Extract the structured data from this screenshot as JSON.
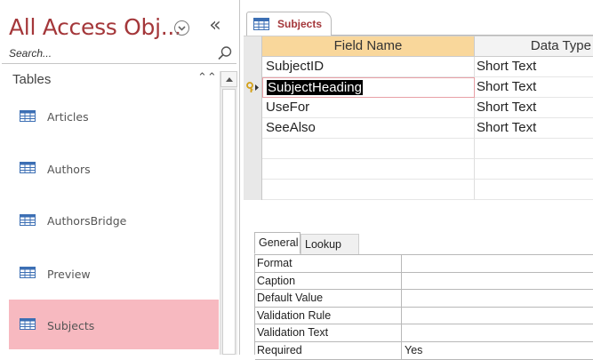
{
  "nav": {
    "title": "All Access Obj...",
    "search_placeholder": "Search...",
    "group_label": "Tables",
    "items": [
      {
        "label": "Articles",
        "icon": "table-icon",
        "selected": false
      },
      {
        "label": "Authors",
        "icon": "table-icon",
        "selected": false
      },
      {
        "label": "AuthorsBridge",
        "icon": "table-icon",
        "selected": false
      },
      {
        "label": "Preview",
        "icon": "table-icon",
        "selected": false
      },
      {
        "label": "Subjects",
        "icon": "table-icon",
        "selected": true
      }
    ]
  },
  "document": {
    "tab_label": "Subjects",
    "columns": {
      "field_name": "Field Name",
      "data_type": "Data Type"
    },
    "fields": [
      {
        "name": "SubjectID",
        "type": "Short Text"
      },
      {
        "name": "SubjectHeading",
        "type": "Short Text"
      },
      {
        "name": "UseFor",
        "type": "Short Text"
      },
      {
        "name": "SeeAlso",
        "type": "Short Text"
      }
    ]
  },
  "properties": {
    "tabs": {
      "general": "General",
      "lookup": "Lookup"
    },
    "rows": [
      {
        "label": "Format",
        "value": ""
      },
      {
        "label": "Caption",
        "value": ""
      },
      {
        "label": "Default Value",
        "value": ""
      },
      {
        "label": "Validation Rule",
        "value": ""
      },
      {
        "label": "Validation Text",
        "value": ""
      },
      {
        "label": "Required",
        "value": "Yes"
      }
    ]
  },
  "colors": {
    "accent": "#a4373a",
    "selected_item": "#f7b9c0",
    "header_highlight": "#f9d79b",
    "key_icon": "#d4a017"
  }
}
